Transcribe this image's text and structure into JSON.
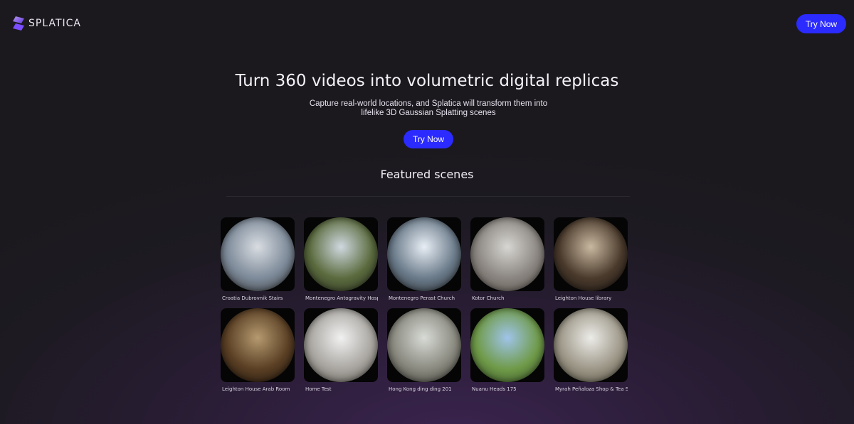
{
  "header": {
    "logo_text": "SPLATICA",
    "try_now_label": "Try Now"
  },
  "hero": {
    "title": "Turn 360 videos into volumetric digital replicas",
    "subtitle_line1": "Capture real-world locations, and Splatica will transform them into",
    "subtitle_line2": "lifelike 3D Gaussian Splatting scenes",
    "cta_label": "Try Now"
  },
  "featured": {
    "title": "Featured scenes",
    "scenes": [
      {
        "label": "Croatia Dubrovnik Stairs",
        "colors": [
          "#d9dde2",
          "#7d8a99",
          "#3a3a3c"
        ]
      },
      {
        "label": "Montenegro Antogravity Hosp...",
        "colors": [
          "#cfd8e0",
          "#5b6b3e",
          "#2b2f23"
        ]
      },
      {
        "label": "Montenegro Perast Church",
        "colors": [
          "#e8eef5",
          "#6b7b8a",
          "#2b2f34"
        ]
      },
      {
        "label": "Kotor Church",
        "colors": [
          "#d7d6d2",
          "#8a8580",
          "#5a534c"
        ]
      },
      {
        "label": "Leighton House library",
        "colors": [
          "#c9b8a0",
          "#4a3a2c",
          "#1a1512"
        ]
      },
      {
        "label": "Leighton House Arab Room",
        "colors": [
          "#b59a70",
          "#5a3f24",
          "#1e150d"
        ]
      },
      {
        "label": "Home Test",
        "colors": [
          "#f1f1f1",
          "#a9a6a1",
          "#5c574f"
        ]
      },
      {
        "label": "Hong Kong ding ding 201",
        "colors": [
          "#d8dbd6",
          "#8a8a80",
          "#3e3d37"
        ]
      },
      {
        "label": "Nuanu Heads 175",
        "colors": [
          "#9fc4ea",
          "#6f9a48",
          "#38502a"
        ]
      },
      {
        "label": "Myrah Peñaloza Shop & Tea S...",
        "colors": [
          "#ecece8",
          "#9d9788",
          "#53503f"
        ]
      }
    ]
  },
  "colors": {
    "accent": "#2b2bff",
    "background": "#1b191e"
  }
}
